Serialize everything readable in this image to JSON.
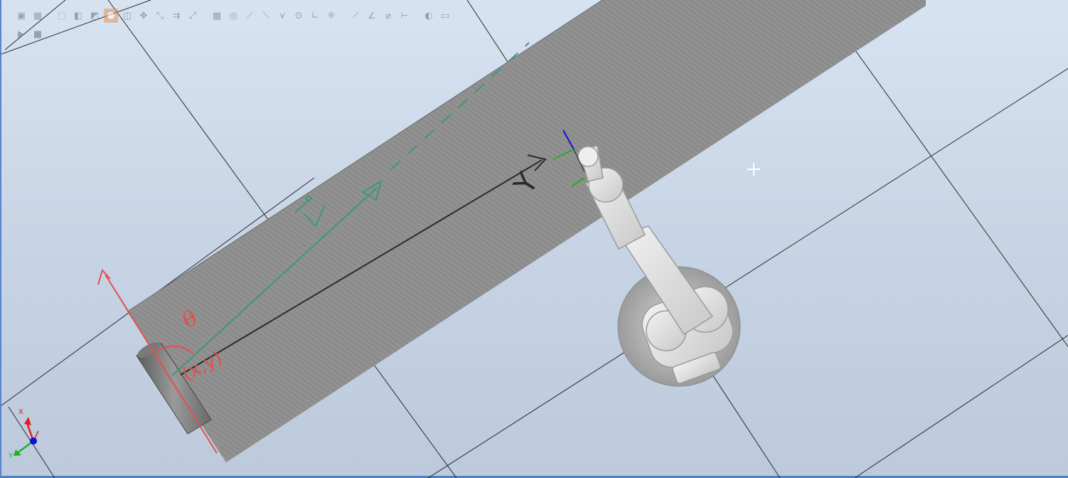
{
  "toolbar": {
    "row1": [
      {
        "name": "view-shaded-icon",
        "glyph": "▣",
        "interactable": true
      },
      {
        "name": "view-wireframe-icon",
        "glyph": "▦",
        "interactable": true
      },
      {
        "name": "select-curve-icon",
        "glyph": "⬚",
        "interactable": true
      },
      {
        "name": "select-surface-icon",
        "glyph": "◧",
        "interactable": true
      },
      {
        "name": "select-body-icon",
        "glyph": "◩",
        "interactable": true
      },
      {
        "name": "select-part-icon",
        "glyph": "⬣",
        "interactable": true,
        "active": true
      },
      {
        "name": "select-group-icon",
        "glyph": "◫",
        "interactable": true
      },
      {
        "name": "select-mechanism-icon",
        "glyph": "✥",
        "interactable": true
      },
      {
        "name": "select-target-icon",
        "glyph": "⤡",
        "interactable": true
      },
      {
        "name": "select-path-icon",
        "glyph": "⇉",
        "interactable": true
      },
      {
        "name": "select-frame-icon",
        "glyph": "⤢",
        "interactable": true
      },
      {
        "name": "snap-object-icon",
        "glyph": "▩",
        "interactable": true
      },
      {
        "name": "snap-center-icon",
        "glyph": "◎",
        "interactable": true
      },
      {
        "name": "snap-edge-icon",
        "glyph": "⟋",
        "interactable": true
      },
      {
        "name": "snap-midpoint-icon",
        "glyph": "⟍",
        "interactable": true
      },
      {
        "name": "snap-end-icon",
        "glyph": "⋎",
        "interactable": true
      },
      {
        "name": "snap-gravity-icon",
        "glyph": "⊙",
        "interactable": true
      },
      {
        "name": "snap-local-origin-icon",
        "glyph": "∟",
        "interactable": true
      },
      {
        "name": "snap-grid-icon",
        "glyph": "⁜",
        "interactable": true
      },
      {
        "name": "measure-distance-icon",
        "glyph": "⟋",
        "interactable": true
      },
      {
        "name": "measure-angle-icon",
        "glyph": "∠",
        "interactable": true
      },
      {
        "name": "measure-diameter-icon",
        "glyph": "⌀",
        "interactable": true
      },
      {
        "name": "measure-minimum-distance-icon",
        "glyph": "⊢",
        "interactable": true
      },
      {
        "name": "hide-icon",
        "glyph": "◐",
        "interactable": true
      },
      {
        "name": "show-icon",
        "glyph": "▭",
        "interactable": true
      }
    ],
    "row2": [
      {
        "name": "play-simulation-icon",
        "glyph": "▶",
        "interactable": true
      },
      {
        "name": "stop-simulation-icon",
        "glyph": "■",
        "interactable": true
      }
    ]
  },
  "annotations": {
    "y_label": "Y",
    "theta_label": "θ",
    "xy_label": "(x,y)"
  },
  "axis_indicator": {
    "x_label": "X",
    "y_label": "Y",
    "x_color": "#e02020",
    "y_color": "#20b020",
    "z_color": "#1010d0"
  },
  "colors": {
    "background_top": "#d7e3f1",
    "background_bottom": "#bccadc",
    "grid_line": "#2a2a2a",
    "conveyor": "#8a8a8a",
    "annotation_red": "#e0504f",
    "annotation_green": "#3a9a74",
    "annotation_black": "#2a2a2a",
    "viewport_border": "#4f7fc4"
  }
}
